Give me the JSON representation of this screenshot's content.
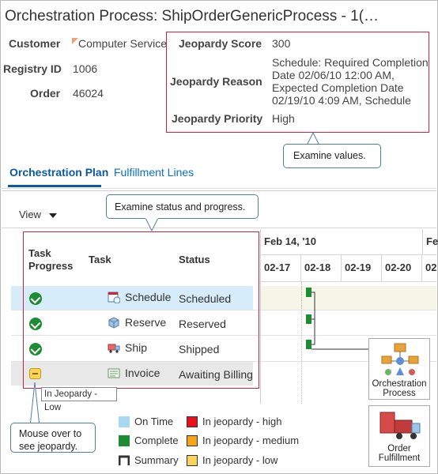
{
  "header": {
    "title": "Orchestration Process: ShipOrderGenericProcess - 1(…",
    "customer_label": "Customer",
    "customer_value": "Computer Service",
    "registry_label": "Registry ID",
    "registry_value": "1006",
    "order_label": "Order",
    "order_value": "46024",
    "jeopardy_score_label": "Jeopardy Score",
    "jeopardy_score_value": "300",
    "jeopardy_reason_label": "Jeopardy Reason",
    "jeopardy_reason_lines": [
      "Schedule: Required Completion",
      "Date 02/06/10 12:00 AM,",
      "Expected Completion Date",
      "02/19/10 4:09 AM, Schedule"
    ],
    "jeopardy_priority_label": "Jeopardy Priority",
    "jeopardy_priority_value": "High"
  },
  "callouts": {
    "examine_values": "Examine values.",
    "examine_status": "Examine status and progress.",
    "mouse_over": [
      "Mouse over  to",
      "see jeopardy."
    ]
  },
  "tabs": [
    {
      "label": "Orchestration Plan",
      "active": true
    },
    {
      "label": "Fulfillment Lines",
      "active": false
    }
  ],
  "toolbar": {
    "view_label": "View"
  },
  "table": {
    "headers": {
      "progress": [
        "Task",
        "Progress"
      ],
      "task": "Task",
      "status": "Status"
    },
    "rows": [
      {
        "task": "Schedule",
        "status": "Scheduled",
        "progress": "complete",
        "icon": "calendar-icon"
      },
      {
        "task": "Reserve",
        "status": "Reserved",
        "progress": "complete",
        "icon": "box-icon"
      },
      {
        "task": "Ship",
        "status": "Shipped",
        "progress": "complete",
        "icon": "truck-icon"
      },
      {
        "task": "Invoice",
        "status": "Awaiting Billing",
        "progress": "in-jeopardy-low",
        "icon": "invoice-icon"
      }
    ],
    "tooltip": "In Jeopardy - Low"
  },
  "gantt": {
    "week_label": "Feb 14, '10",
    "week_label_next": "Fe",
    "days": [
      "02-17",
      "02-18",
      "02-19",
      "02-20",
      "02"
    ]
  },
  "legend": [
    {
      "label": "On Time",
      "color": "#a9d8f2"
    },
    {
      "label": "In jeopardy - high",
      "color": "#e8101a"
    },
    {
      "label": "Complete",
      "color": "#1e8c32"
    },
    {
      "label": "In jeopardy - medium",
      "color": "#f5a51c"
    },
    {
      "label": "Summary",
      "color": "#333333"
    },
    {
      "label": "In jeopardy - low",
      "color": "#f9d35a"
    }
  ],
  "side_buttons": {
    "orchestration_process": [
      "Orchestration",
      "Process"
    ],
    "order_fulfillment": [
      "Order",
      "Fulfillment"
    ]
  }
}
